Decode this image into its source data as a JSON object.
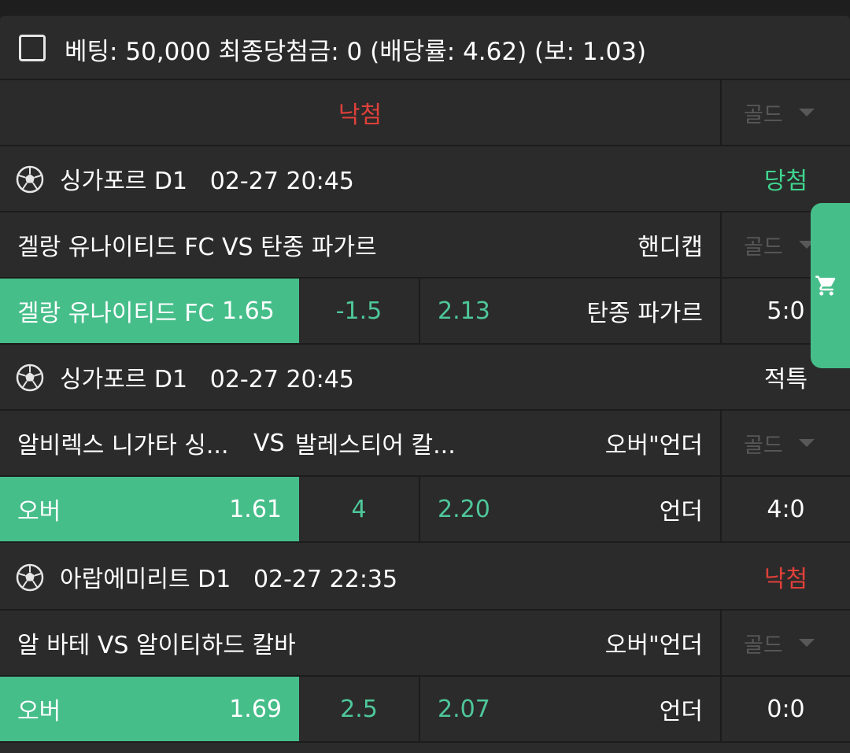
{
  "summary": {
    "text": "베팅: 50,000 최종당첨금: 0 (배당률: 4.62) (보: 1.03)"
  },
  "result_row": {
    "label": "낙첨",
    "gold": "골드"
  },
  "games": [
    {
      "league": "싱가포르 D1",
      "datetime": "02-27 20:45",
      "status": "당첨",
      "match": "겔랑 유나이티드 FC VS 탄종 파가르",
      "bet_type": "핸디캡",
      "gold": "골드",
      "home_label": "겔랑 유나이티드 FC",
      "home_odds": "1.65",
      "line": "-1.5",
      "away_odds": "2.13",
      "away_label": "탄종 파가르",
      "score": "5:0"
    },
    {
      "league": "싱가포르 D1",
      "datetime": "02-27 20:45",
      "status": "적특",
      "match_home": "알비렉스 니가타 싱...",
      "match_vs": "VS",
      "match_away": "발레스티어 칼...",
      "bet_type": "오버\"언더",
      "gold": "골드",
      "home_label": "오버",
      "home_odds": "1.61",
      "line": "4",
      "away_odds": "2.20",
      "away_label": "언더",
      "score": "4:0"
    },
    {
      "league": "아랍에미리트 D1",
      "datetime": "02-27 22:35",
      "status": "낙첨",
      "match": "알 바테 VS 알이티하드 칼바",
      "bet_type": "오버\"언더",
      "gold": "골드",
      "home_label": "오버",
      "home_odds": "1.69",
      "line": "2.5",
      "away_odds": "2.07",
      "away_label": "언더",
      "score": "0:0"
    }
  ],
  "icons": {
    "checkbox": "checkbox-unchecked-icon",
    "soccer": "soccer-ball-icon",
    "caret": "caret-down-icon",
    "cart": "cart-icon"
  },
  "colors": {
    "accent_green": "#46be8a",
    "win_green": "#3fd58e",
    "lose_red": "#e0403a",
    "odds_green": "#4ec79a"
  }
}
